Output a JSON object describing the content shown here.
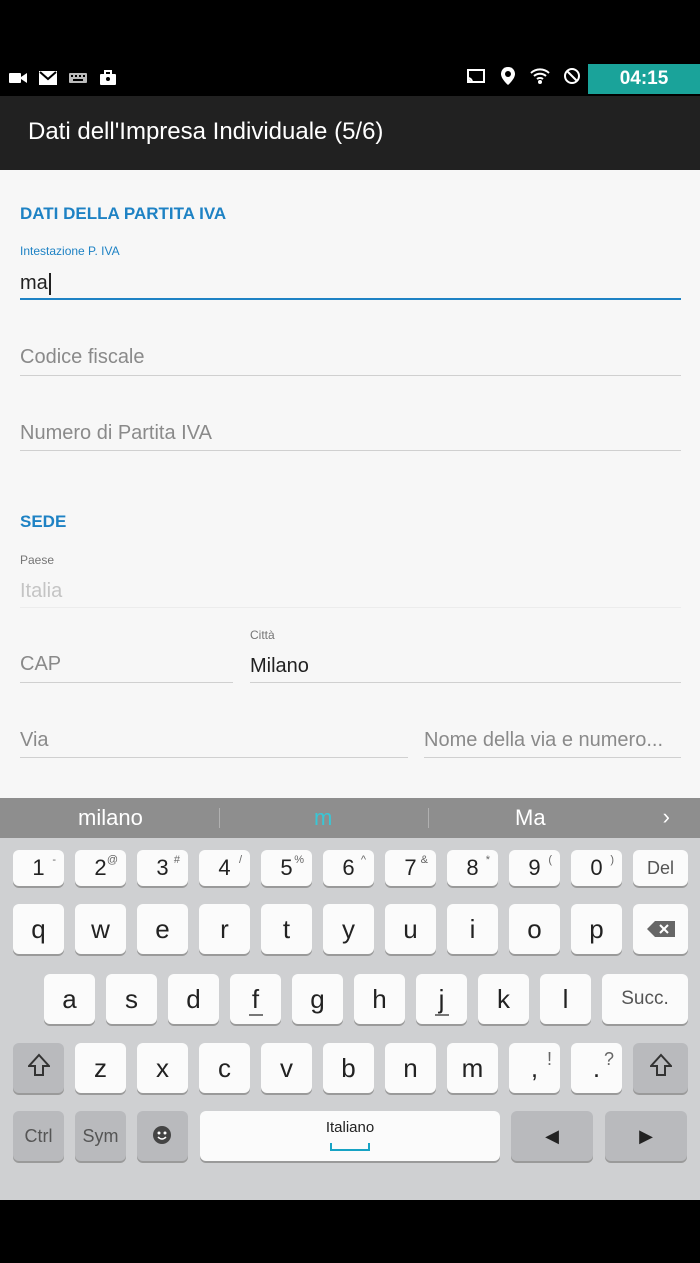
{
  "status": {
    "left_icons": [
      "video-icon",
      "gmail-icon",
      "keyboard-icon",
      "briefcase-icon"
    ],
    "right_icons": [
      "cast-icon",
      "location-icon",
      "wifi-icon",
      "do-not-disturb-icon"
    ],
    "time": "04:15"
  },
  "app_bar": {
    "title": "Dati dell'Impresa Individuale (5/6)"
  },
  "form": {
    "section_partita_iva": "DATI DELLA PARTITA IVA",
    "intestazione": {
      "label": "Intestazione P. IVA",
      "value": "ma"
    },
    "codice_fiscale": {
      "placeholder": "Codice fiscale"
    },
    "numero_partita_iva": {
      "placeholder": "Numero di Partita IVA"
    },
    "section_sede": "SEDE",
    "paese": {
      "label": "Paese",
      "value": "Italia"
    },
    "cap": {
      "placeholder": "CAP"
    },
    "citta": {
      "label": "Città",
      "value": "Milano"
    },
    "via": {
      "placeholder": "Via"
    },
    "nome_via": {
      "placeholder": "Nome della via e numero..."
    }
  },
  "suggestions": {
    "left": "milano",
    "middle": "m",
    "right": "Ma",
    "arrow": "›"
  },
  "keyboard": {
    "row1": [
      [
        "1",
        "-"
      ],
      [
        "2",
        "@"
      ],
      [
        "3",
        "#"
      ],
      [
        "4",
        "/"
      ],
      [
        "5",
        "%"
      ],
      [
        "6",
        "^"
      ],
      [
        "7",
        "&"
      ],
      [
        "8",
        "*"
      ],
      [
        "9",
        "("
      ],
      [
        "0",
        ")"
      ]
    ],
    "del": "Del",
    "row2": [
      "q",
      "w",
      "e",
      "r",
      "t",
      "y",
      "u",
      "i",
      "o",
      "p"
    ],
    "row3": [
      "a",
      "s",
      "d",
      "f",
      "g",
      "h",
      "j",
      "k",
      "l"
    ],
    "succ": "Succ.",
    "row4": [
      "z",
      "x",
      "c",
      "v",
      "b",
      "n",
      "m"
    ],
    "comma": [
      ",",
      "!"
    ],
    "period": [
      ".",
      "?"
    ],
    "ctrl": "Ctrl",
    "sym": "Sym",
    "space_lang": "Italiano",
    "arrow_left": "◀",
    "arrow_right": "▶"
  },
  "colors": {
    "accent": "#1e82c4",
    "clock_bg": "#1aa39a",
    "app_bar": "#212121"
  }
}
